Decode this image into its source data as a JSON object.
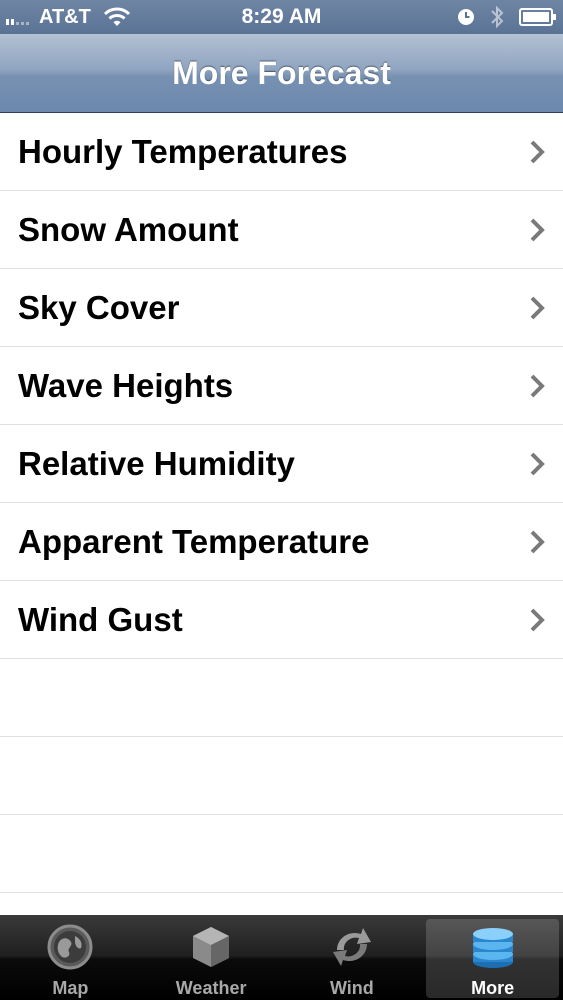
{
  "status_bar": {
    "carrier": "AT&T",
    "time": "8:29 AM",
    "icons": [
      "signal-icon",
      "wifi-icon",
      "clock-icon",
      "bluetooth-icon",
      "battery-icon"
    ]
  },
  "nav": {
    "title": "More Forecast"
  },
  "list": {
    "items": [
      {
        "label": "Hourly Temperatures"
      },
      {
        "label": "Snow Amount"
      },
      {
        "label": "Sky Cover"
      },
      {
        "label": "Wave Heights"
      },
      {
        "label": "Relative Humidity"
      },
      {
        "label": "Apparent Temperature"
      },
      {
        "label": "Wind Gust"
      }
    ],
    "chevron_icon": "chevron-right-icon"
  },
  "tab_bar": {
    "tabs": [
      {
        "label": "Map",
        "icon": "globe-icon",
        "active": false
      },
      {
        "label": "Weather",
        "icon": "cube-icon",
        "active": false
      },
      {
        "label": "Wind",
        "icon": "refresh-arrows-icon",
        "active": false
      },
      {
        "label": "More",
        "icon": "database-stack-icon",
        "active": true
      }
    ]
  },
  "colors": {
    "nav_bar": "#7f97b8",
    "tab_active_icon": "#3aa0e6",
    "tab_inactive_label": "#a8a8a8"
  }
}
